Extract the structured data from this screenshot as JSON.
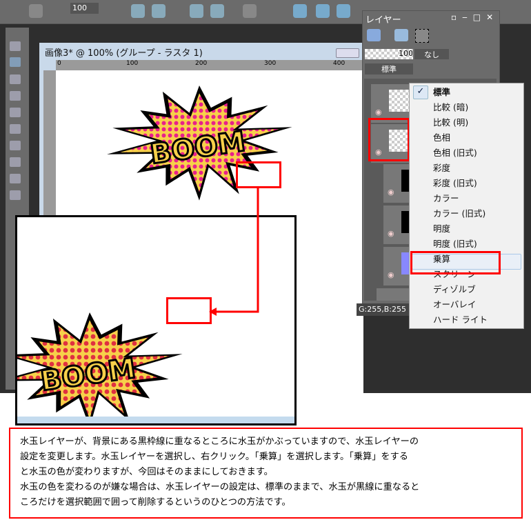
{
  "toolbar": {
    "zoom_value": "100"
  },
  "image_window": {
    "title": "画像3* @ 100% (グループ - ラスタ 1)",
    "ruler_labels": [
      "0",
      "100",
      "200",
      "300",
      "400"
    ]
  },
  "artwork": {
    "text": "BOOM",
    "dot_color": "#e8208a",
    "dot_color_multiply": "#e03040",
    "fill_color": "#f7d04a"
  },
  "layers_panel": {
    "title": "レイヤー",
    "opacity": "100",
    "link_label": "なし",
    "blend_mode": "標準"
  },
  "status_text": "G:255,B:255",
  "blend_menu": {
    "items": [
      "標準",
      "比較 (暗)",
      "比較 (明)",
      "色相",
      "色相 (旧式)",
      "彩度",
      "彩度 (旧式)",
      "カラー",
      "カラー (旧式)",
      "明度",
      "明度 (旧式)",
      "乗算",
      "スクリーン",
      "ディゾルブ",
      "オーバレイ",
      "ハード ライト"
    ],
    "checked": "標準",
    "highlighted": "乗算"
  },
  "note": {
    "lines": [
      "水玉レイヤーが、背景にある黒枠線に重なるところに水玉がかぶっていますので、水玉レイヤーの",
      "設定を変更します。水玉レイヤーを選択し、右クリック。「乗算」を選択します。「乗算」をする",
      "と水玉の色が変わりますが、今回はそのままにしておきます。",
      "水玉の色を変わるのが嫌な場合は、水玉レイヤーの設定は、標準のままで、水玉が黒線に重なると",
      "ころだけを選択範囲で囲って削除するというのひとつの方法です。"
    ]
  },
  "accent": "#ff0000"
}
